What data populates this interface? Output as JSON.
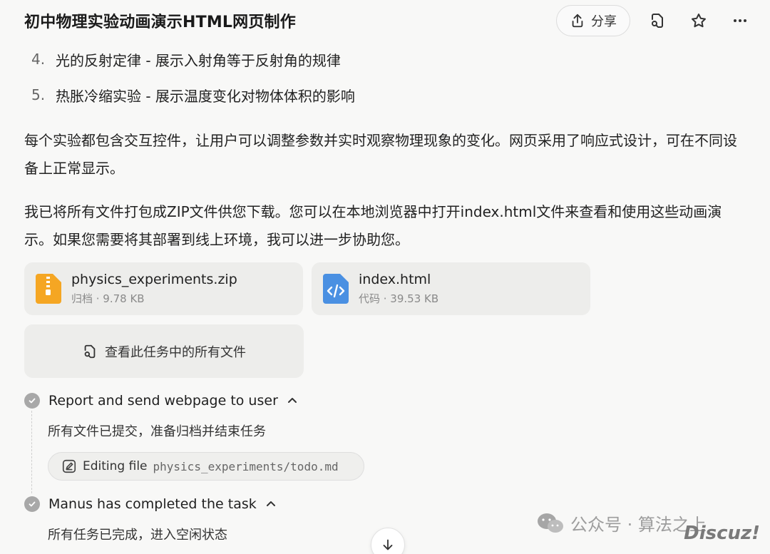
{
  "header": {
    "title": "初中物理实验动画演示HTML网页制作",
    "share_label": "分享",
    "icons": [
      "share-icon",
      "file-search-icon",
      "star-icon",
      "more-icon"
    ]
  },
  "list": [
    {
      "num": "4.",
      "text": "光的反射定律 - 展示入射角等于反射角的规律"
    },
    {
      "num": "5.",
      "text": "热胀冷缩实验 - 展示温度变化对物体体积的影响"
    }
  ],
  "paragraphs": {
    "p1": "每个实验都包含交互控件，让用户可以调整参数并实时观察物理现象的变化。网页采用了响应式设计，可在不同设备上正常显示。",
    "p2": "我已将所有文件打包成ZIP文件供您下载。您可以在本地浏览器中打开index.html文件来查看和使用这些动画演示。如果您需要将其部署到线上环境，我可以进一步协助您。"
  },
  "files": [
    {
      "name": "physics_experiments.zip",
      "meta": "归档 · 9.78 KB",
      "icon": "zip-file-icon",
      "color": "#f5a623"
    },
    {
      "name": "index.html",
      "meta": "代码 · 39.53 KB",
      "icon": "code-file-icon",
      "color": "#4a90e2"
    }
  ],
  "view_all_label": "查看此任务中的所有文件",
  "steps": [
    {
      "title": "Report and send webpage to user",
      "desc": "所有文件已提交，准备归档并结束任务"
    },
    {
      "title": "Manus has completed the task",
      "desc": "所有任务已完成，进入空闲状态"
    }
  ],
  "edit_chip": {
    "label": "Editing file",
    "path": "physics_experiments/todo.md"
  },
  "watermark": {
    "text": "公众号 · 算法之上",
    "logo": "Discuz!"
  }
}
